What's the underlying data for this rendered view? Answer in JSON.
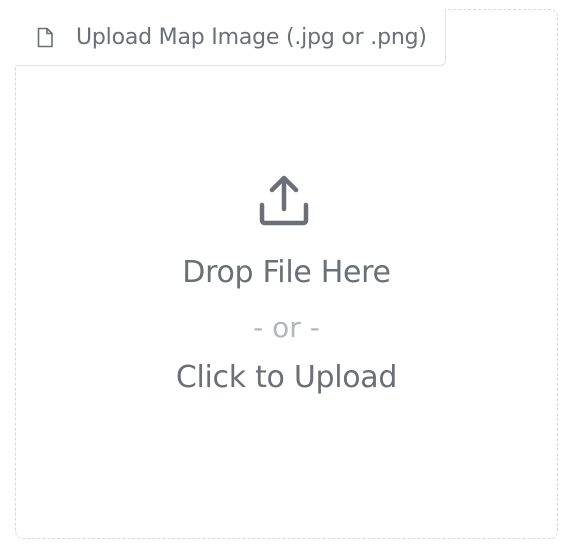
{
  "upload": {
    "label": "Upload Map Image (.jpg or .png)",
    "label_icon": "file-icon",
    "upload_icon": "upload-icon",
    "drop_text": "Drop File Here",
    "or_text": "- or -",
    "click_text": "Click to Upload"
  },
  "colors": {
    "text_primary": "#6b6f78",
    "text_muted": "#b3b6bc",
    "border": "#d6d7db"
  }
}
